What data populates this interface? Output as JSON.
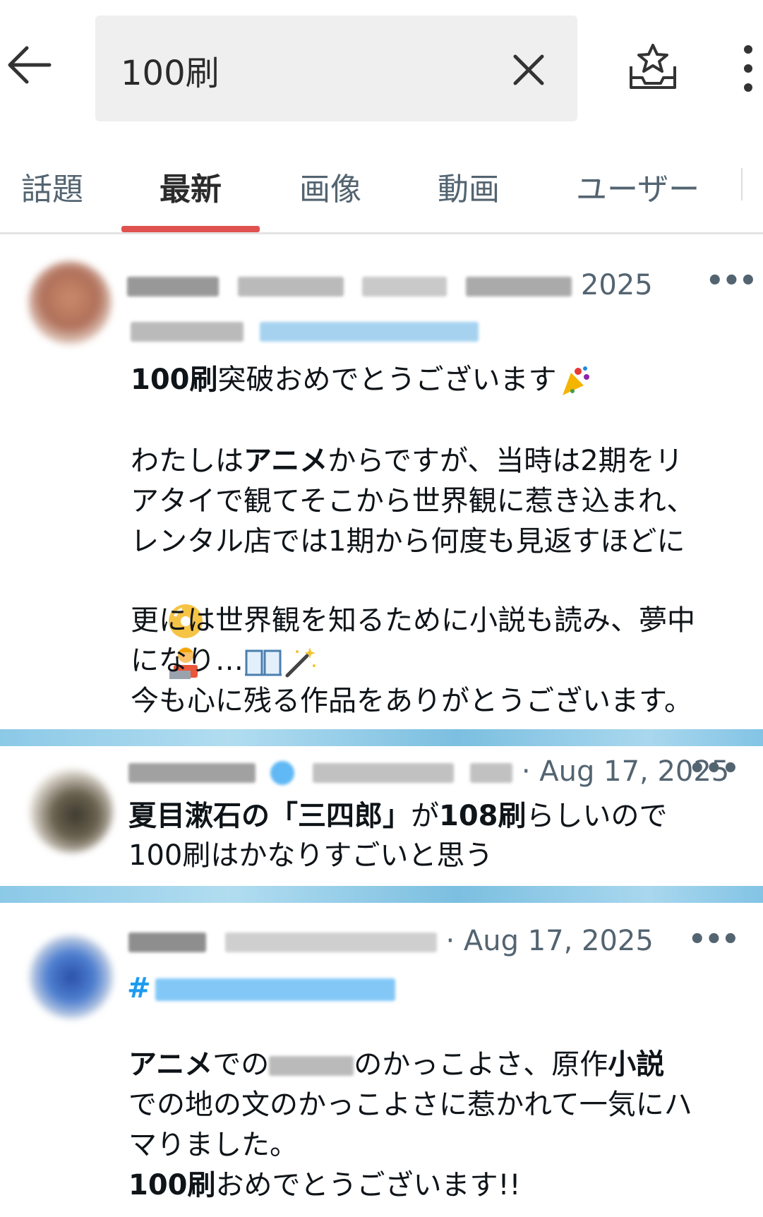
{
  "search": {
    "query": "100刷"
  },
  "tabs": [
    {
      "label": "話題"
    },
    {
      "label": "最新"
    },
    {
      "label": "画像"
    },
    {
      "label": "動画"
    },
    {
      "label": "ユーザー"
    }
  ],
  "tweets": [
    {
      "date": "2025",
      "body_bold_1": "100刷",
      "body_line_1": "突破おめでとうございます",
      "body_p2_a": "わたしは",
      "body_p2_bold": "アニメ",
      "body_p2_b": "からですが、当時は2期をリ",
      "body_line_3": "アタイで観てそこから世界観に惹き込まれ、",
      "body_line_4": "レンタル店では1期から何度も見返すほどに",
      "body_line_6": "更には世界観を知るために小説も読み、夢中",
      "body_line_7": "になり…",
      "body_line_8": "今も心に残る作品をありがとうございます。"
    },
    {
      "date": "· Aug 17, 2025",
      "body_bold_1": "夏目漱石の「三四郎」",
      "body_mid": "が",
      "body_bold_2": "108刷",
      "body_end": "らしいので",
      "body_line_2": "100刷はかなりすごいと思う"
    },
    {
      "date": "· Aug 17, 2025",
      "hashtag": "#",
      "body_bold_1": "アニメ",
      "body_a": "での",
      "body_b": "のかっこよさ、原作",
      "body_bold_2": "小説",
      "body_line_2": "での地の文のかっこよさに惹かれて一気にハ",
      "body_line_3": "マりました。",
      "body_bold_3": "100刷",
      "body_line_4": "おめでとうございます!!"
    }
  ],
  "icons": {
    "back": "arrow-left-icon",
    "clear": "close-icon",
    "save": "save-search-icon",
    "more": "more-vertical-icon"
  },
  "colors": {
    "accent_underline": "#e0524f",
    "hashtag": "#1d9bf0",
    "secondary_text": "#536471"
  }
}
